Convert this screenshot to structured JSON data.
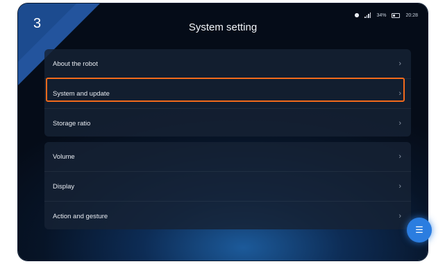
{
  "step_number": "3",
  "header": {
    "title": "System setting"
  },
  "status_bar": {
    "battery": "34%",
    "time": "20:28"
  },
  "settings": {
    "group1": [
      {
        "label": "About the robot"
      },
      {
        "label": "System and update"
      },
      {
        "label": "Storage ratio"
      }
    ],
    "group2": [
      {
        "label": "Volume"
      },
      {
        "label": "Display"
      },
      {
        "label": "Action and gesture"
      }
    ]
  },
  "icons": {
    "chevron": "chevron-right-icon",
    "fab": "menu-icon"
  },
  "colors": {
    "highlight": "#f26a1b",
    "accent": "#2b7de0"
  }
}
